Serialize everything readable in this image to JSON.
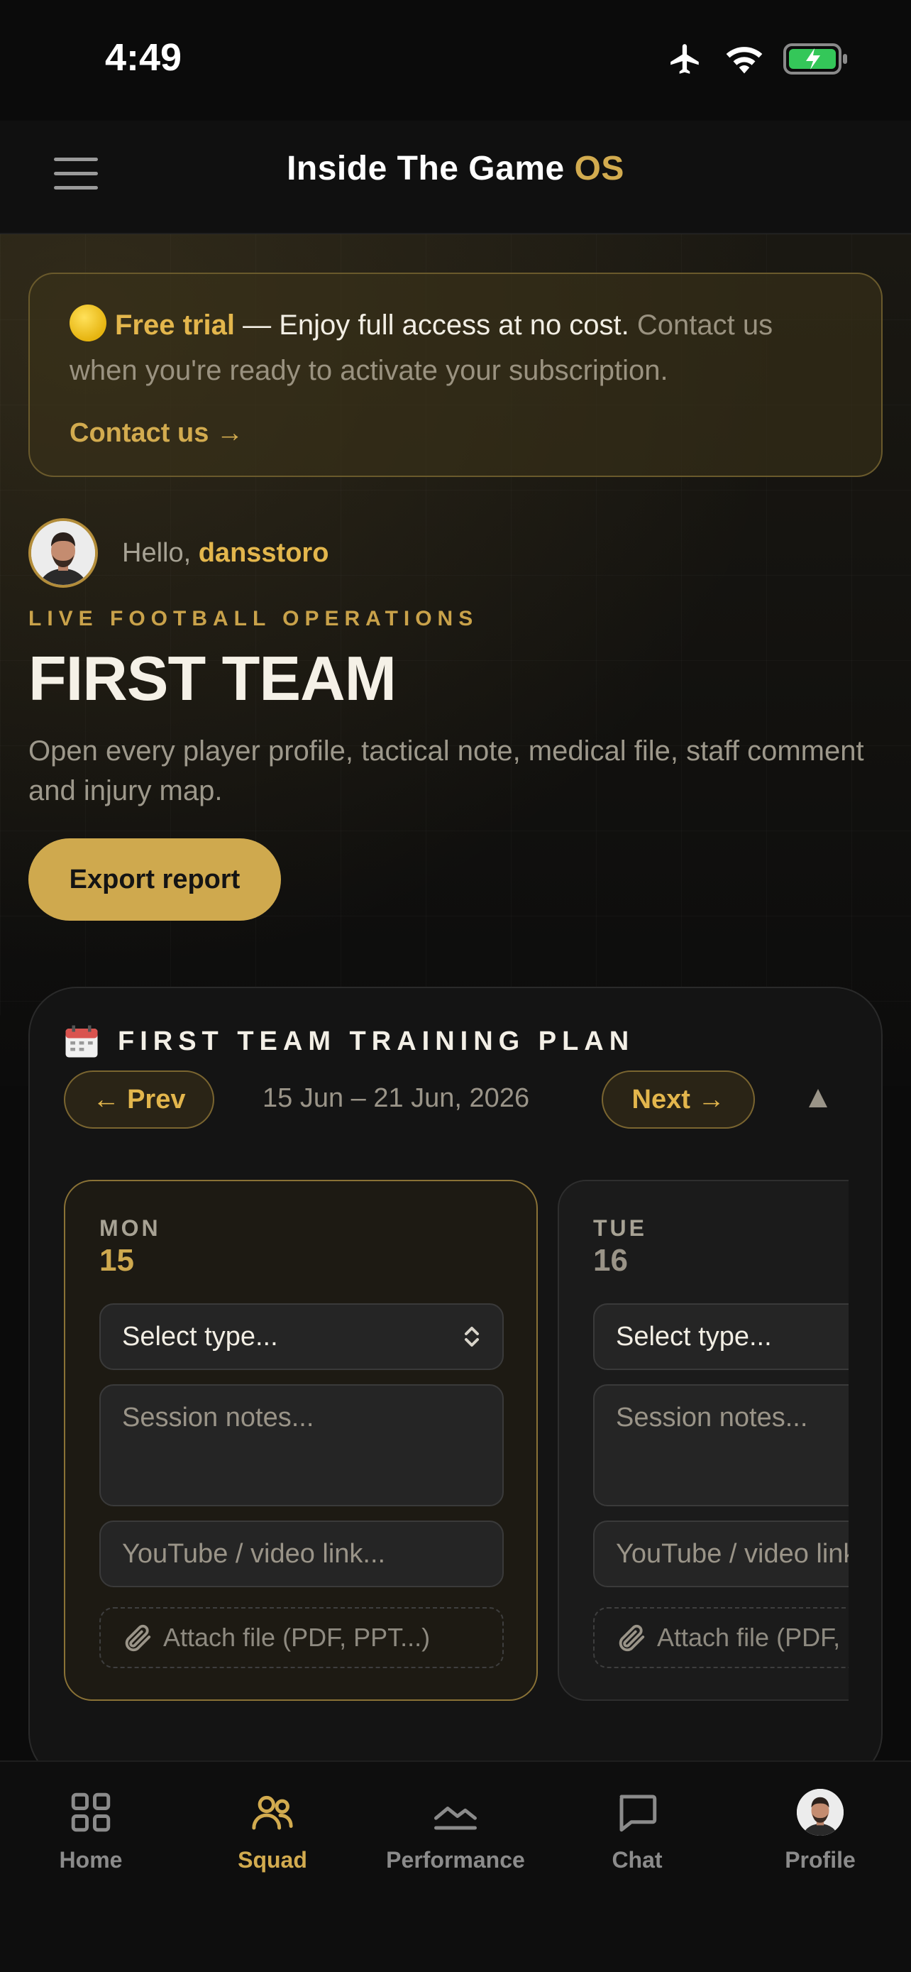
{
  "status_bar": {
    "time": "4:49"
  },
  "header": {
    "title_main": "Inside The Game",
    "title_accent": "OS"
  },
  "trial": {
    "strong": "Free trial",
    "lead": " — Enjoy full access at no cost.",
    "rest": " Contact us when you're ready to activate your subscription.",
    "link": "Contact us →"
  },
  "greeting": {
    "prefix": "Hello, ",
    "username": "dansstoro"
  },
  "page": {
    "eyebrow": "LIVE FOOTBALL OPERATIONS",
    "title": "FIRST TEAM",
    "description": "Open every player profile, tactical note, medical file, staff comment and injury map.",
    "export_label": "Export report"
  },
  "plan": {
    "title": "FIRST TEAM TRAINING PLAN",
    "prev_label": "← Prev",
    "next_label": "Next →",
    "date_range": "15 Jun – 21 Jun, 2026",
    "days": [
      {
        "dow": "MON",
        "num": "15"
      },
      {
        "dow": "TUE",
        "num": "16"
      }
    ],
    "select_placeholder": "Select type...",
    "notes_placeholder": "Session notes...",
    "video_placeholder": "YouTube / video link...",
    "attach_label": "Attach file (PDF, PPT...)"
  },
  "nav": {
    "items": [
      {
        "label": "Home",
        "icon": "grid-icon"
      },
      {
        "label": "Squad",
        "icon": "users-icon",
        "active": true
      },
      {
        "label": "Performance",
        "icon": "chart-line-icon"
      },
      {
        "label": "Chat",
        "icon": "chat-bubble-icon"
      },
      {
        "label": "Profile",
        "icon": "avatar"
      }
    ]
  },
  "colors": {
    "accent": "#d2ab4f",
    "background": "#0b0b0b",
    "battery": "#34c759"
  }
}
